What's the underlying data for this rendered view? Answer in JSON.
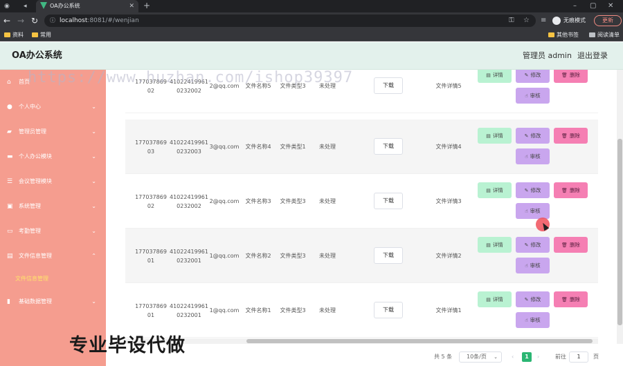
{
  "browser": {
    "tab_title": "OA办公系统",
    "url_host": "localhost",
    "url_path": ":8081/#/wenjian",
    "incognito_label": "无痕模式",
    "update_label": "更新",
    "bookmarks": [
      "资料",
      "常用"
    ],
    "bookmarks_right": [
      "其他书签",
      "阅读清单"
    ]
  },
  "header": {
    "title": "OA办公系统",
    "user": "管理员 admin",
    "logout": "退出登录"
  },
  "sidebar": {
    "items": [
      {
        "label": "首页",
        "icon": "home-icon"
      },
      {
        "label": "个人中心",
        "icon": "user-icon"
      },
      {
        "label": "管理员管理",
        "icon": "briefcase-icon"
      },
      {
        "label": "个人办公模块",
        "icon": "case-icon"
      },
      {
        "label": "会议管理模块",
        "icon": "sliders-icon"
      },
      {
        "label": "系统管理",
        "icon": "settings-icon"
      },
      {
        "label": "考勤管理",
        "icon": "card-icon"
      },
      {
        "label": "文件信息管理",
        "icon": "document-icon"
      },
      {
        "label": "基础数据管理",
        "icon": "chart-icon"
      }
    ],
    "active_sub": "文件信息管理"
  },
  "table": {
    "rows": [
      {
        "phone": "17703786902",
        "id": "410224199610232002",
        "email": "2@qq.com",
        "name": "文件名称5",
        "type": "文件类型3",
        "status": "未处理",
        "detail": "文件详情5"
      },
      {
        "phone": "17703786903",
        "id": "410224199610232003",
        "email": "3@qq.com",
        "name": "文件名称4",
        "type": "文件类型1",
        "status": "未处理",
        "detail": "文件详情4"
      },
      {
        "phone": "17703786902",
        "id": "410224199610232002",
        "email": "2@qq.com",
        "name": "文件名称3",
        "type": "文件类型3",
        "status": "未处理",
        "detail": "文件详情3"
      },
      {
        "phone": "17703786901",
        "id": "410224199610232001",
        "email": "1@qq.com",
        "name": "文件名称2",
        "type": "文件类型3",
        "status": "未处理",
        "detail": "文件详情2"
      },
      {
        "phone": "17703786901",
        "id": "410224199610232001",
        "email": "1@qq.com",
        "name": "文件名称1",
        "type": "文件类型3",
        "status": "未处理",
        "detail": "文件详情1"
      }
    ],
    "download_label": "下载",
    "detail_label": "详情",
    "edit_label": "修改",
    "delete_label": "删除",
    "audit_label": "审核"
  },
  "pagination": {
    "total": "共 5 条",
    "page_size": "10条/页",
    "current": "1",
    "goto_label": "前往",
    "goto_value": "1",
    "page_suffix": "页"
  },
  "watermark": "https://www.huzhan.com/ishop39397",
  "overlay_text": "专业毕设代做"
}
